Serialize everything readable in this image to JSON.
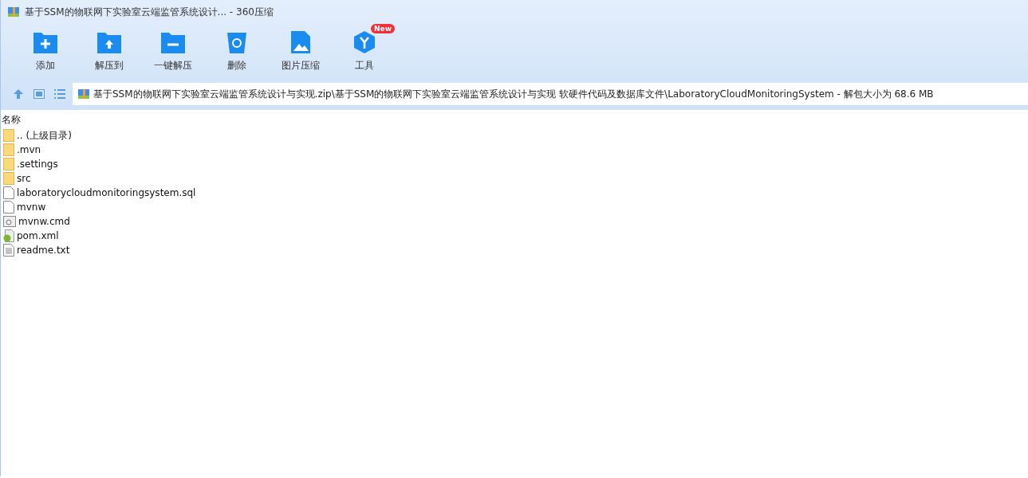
{
  "window": {
    "title": "基于SSM的物联网下实验室云端监管系统设计... - 360压缩"
  },
  "toolbar": [
    {
      "label": "添加",
      "kind": "add"
    },
    {
      "label": "解压到",
      "kind": "extract"
    },
    {
      "label": "一键解压",
      "kind": "oneclick"
    },
    {
      "label": "删除",
      "kind": "delete"
    },
    {
      "label": "图片压缩",
      "kind": "image"
    },
    {
      "label": "工具",
      "kind": "tools",
      "badge": "New"
    }
  ],
  "address_bar": {
    "path": "基于SSM的物联网下实验室云端监管系统设计与实现.zip\\基于SSM的物联网下实验室云端监管系统设计与实现 软硬件代码及数据库文件\\LaboratoryCloudMonitoringSystem - 解包大小为 68.6 MB"
  },
  "file_list": {
    "columns": [
      "名称"
    ],
    "rows": [
      {
        "name": ".. (上级目录)",
        "kind": "folder"
      },
      {
        "name": ".mvn",
        "kind": "folder"
      },
      {
        "name": ".settings",
        "kind": "folder"
      },
      {
        "name": "src",
        "kind": "folder"
      },
      {
        "name": "laboratorycloudmonitoringsystem.sql",
        "kind": "file"
      },
      {
        "name": "mvnw",
        "kind": "file"
      },
      {
        "name": "mvnw.cmd",
        "kind": "cmd"
      },
      {
        "name": "pom.xml",
        "kind": "xml"
      },
      {
        "name": "readme.txt",
        "kind": "txt"
      }
    ]
  }
}
